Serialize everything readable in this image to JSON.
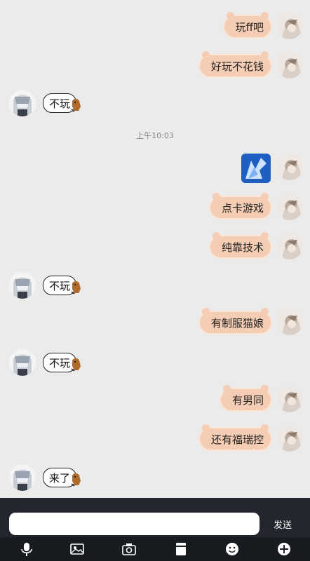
{
  "messages": [
    {
      "side": "right",
      "text": "玩ff吧"
    },
    {
      "side": "right",
      "text": "好玩不花钱"
    },
    {
      "side": "left",
      "text": "不玩"
    },
    {
      "side": "right",
      "text": "点卡游戏"
    },
    {
      "side": "right",
      "text": "纯靠技术"
    },
    {
      "side": "left",
      "text": "不玩"
    },
    {
      "side": "right",
      "text": "有制服猫娘"
    },
    {
      "side": "left",
      "text": "不玩"
    },
    {
      "side": "right",
      "text": "有男同"
    },
    {
      "side": "right",
      "text": "还有福瑞控"
    },
    {
      "side": "left",
      "text": "来了"
    }
  ],
  "timestamp": "上午10:03",
  "composer": {
    "input_value": "",
    "send_label": "发送"
  },
  "toolbar": {
    "icons": [
      "microphone-icon",
      "image-icon",
      "camera-icon",
      "document-icon",
      "emoji-icon",
      "plus-icon"
    ]
  },
  "colors": {
    "chat_background": "#ebebeb",
    "right_bubble": "#f4cdb4",
    "input_bar": "#23272d",
    "toolbar": "#181b20"
  }
}
